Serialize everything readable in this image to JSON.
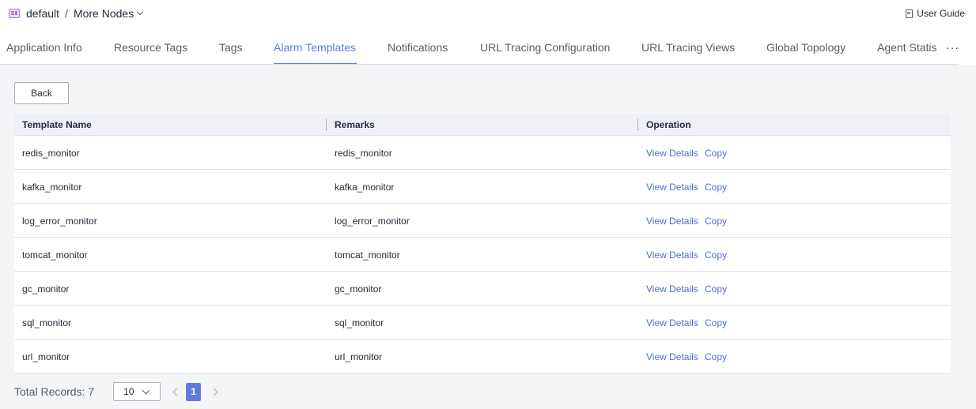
{
  "breadcrumb": {
    "app": "default",
    "separator": "/",
    "node": "More Nodes"
  },
  "header": {
    "user_guide": "User Guide"
  },
  "tabs": [
    {
      "label": "Application Info",
      "active": false
    },
    {
      "label": "Resource Tags",
      "active": false
    },
    {
      "label": "Tags",
      "active": false
    },
    {
      "label": "Alarm Templates",
      "active": true
    },
    {
      "label": "Notifications",
      "active": false
    },
    {
      "label": "URL Tracing Configuration",
      "active": false
    },
    {
      "label": "URL Tracing Views",
      "active": false
    },
    {
      "label": "Global Topology",
      "active": false
    },
    {
      "label": "Agent Statis",
      "active": false
    }
  ],
  "tabs_more": "···",
  "actions": {
    "back": "Back"
  },
  "table": {
    "columns": [
      "Template Name",
      "Remarks",
      "Operation"
    ],
    "rows": [
      {
        "name": "redis_monitor",
        "remarks": "redis_monitor"
      },
      {
        "name": "kafka_monitor",
        "remarks": "kafka_monitor"
      },
      {
        "name": "log_error_monitor",
        "remarks": "log_error_monitor"
      },
      {
        "name": "tomcat_monitor",
        "remarks": "tomcat_monitor"
      },
      {
        "name": "gc_monitor",
        "remarks": "gc_monitor"
      },
      {
        "name": "sql_monitor",
        "remarks": "sql_monitor"
      },
      {
        "name": "url_monitor",
        "remarks": "url_monitor"
      }
    ],
    "op_view": "View Details",
    "op_copy": "Copy"
  },
  "pagination": {
    "total": "Total Records: 7",
    "page_size": "10",
    "current_page": "1"
  },
  "colors": {
    "accent": "#5e7ce0",
    "link": "#526ecc",
    "header_bg": "#eef0f5",
    "content_bg": "#f4f5f7"
  },
  "icons": {
    "app": "app-icon",
    "dropdown": "chevron-down-icon",
    "guide": "document-icon",
    "more": "more-icon",
    "prev": "chevron-left-icon",
    "next": "chevron-right-icon"
  }
}
